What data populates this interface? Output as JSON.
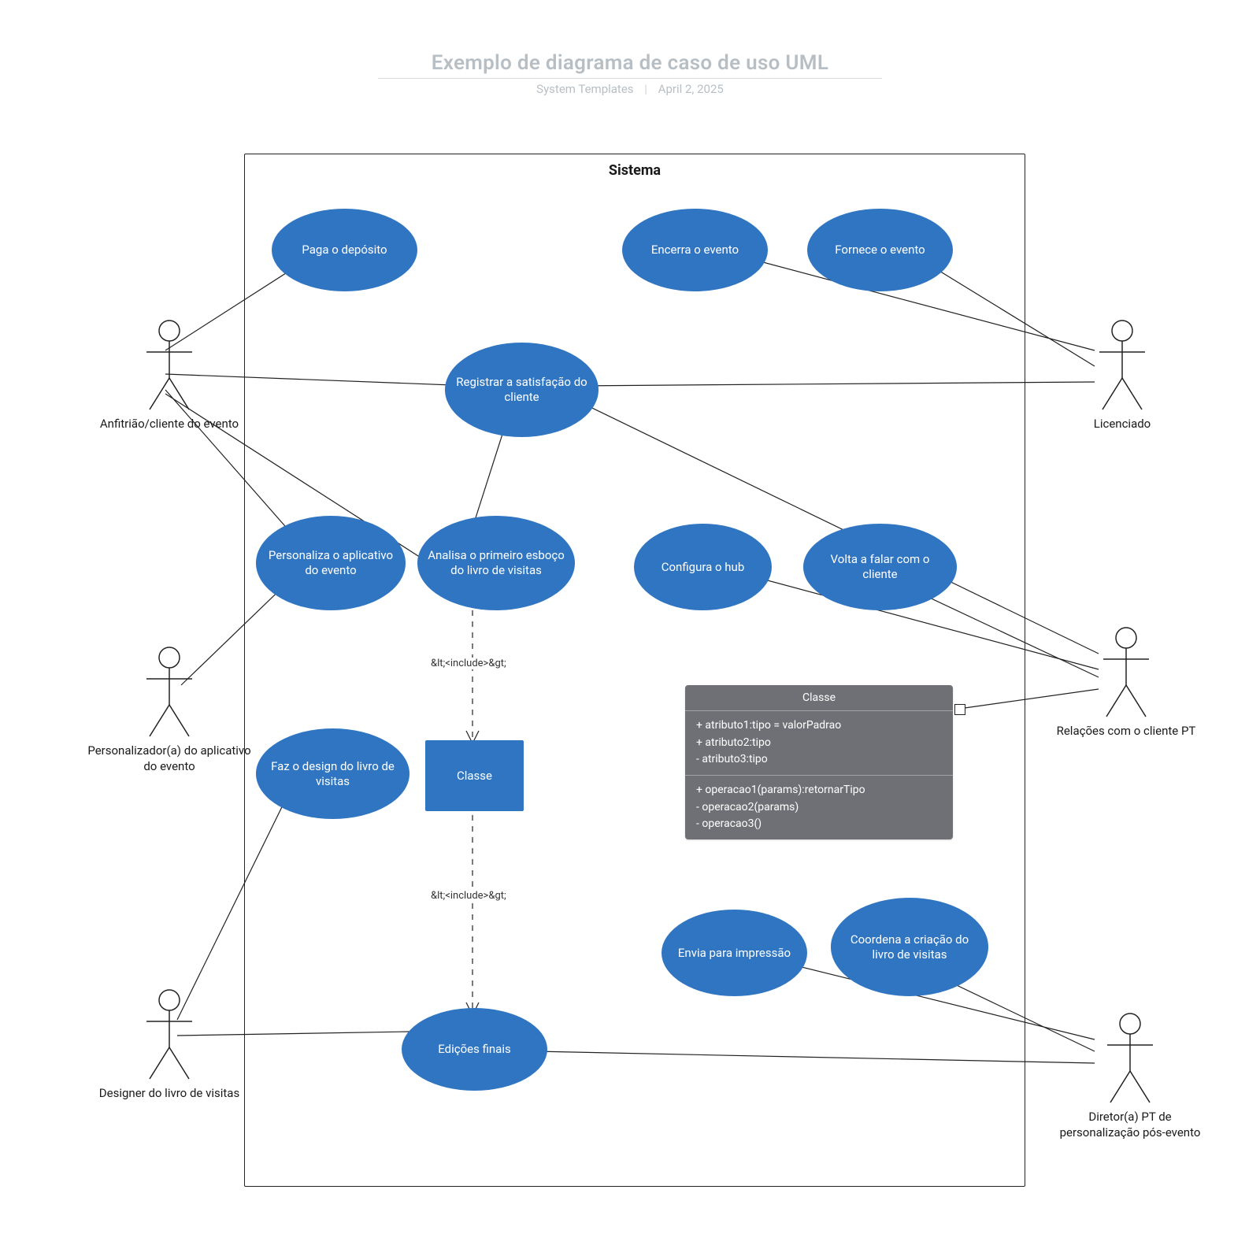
{
  "header": {
    "title": "Exemplo de diagrama de caso de uso UML",
    "byline_author": "System Templates",
    "byline_date": "April 2, 2025"
  },
  "system": {
    "label": "Sistema"
  },
  "usecases": {
    "paga_deposito": "Paga o depósito",
    "encerra_evento": "Encerra o evento",
    "fornece_evento": "Fornece o evento",
    "registrar_satisfacao": "Registrar a satisfação do cliente",
    "personaliza_app": "Personaliza o aplicativo do evento",
    "analisa_esboco": "Analisa o primeiro esboço do livro de visitas",
    "configura_hub": "Configura o hub",
    "volta_falar_cliente": "Volta a falar com o cliente",
    "faz_design": "Faz o design do livro de visitas",
    "envia_impressao": "Envia para impressão",
    "coordena_criacao": "Coordena a criação do livro de visitas",
    "edicoes_finais": "Edições finais"
  },
  "classe_node": {
    "label": "Classe"
  },
  "class_box": {
    "title": "Classe",
    "attrs": [
      "+ atributo1:tipo = valorPadrao",
      "+ atributo2:tipo",
      "- atributo3:tipo"
    ],
    "ops": [
      "+ operacao1(params):retornarTipo",
      "- operacao2(params)",
      "- operacao3()"
    ]
  },
  "actors": {
    "anfitriao": "Anfitrião/cliente do evento",
    "licenciado": "Licenciado",
    "personalizador": "Personalizador(a) do aplicativo do evento",
    "relacoes_pt": "Relações com o cliente PT",
    "designer": "Designer do livro de visitas",
    "diretor_pt": "Diretor(a) PT de personalização pós-evento"
  },
  "edge_labels": {
    "include1": "&lt;<include>&gt;",
    "include2": "&lt;<include>&gt;"
  }
}
